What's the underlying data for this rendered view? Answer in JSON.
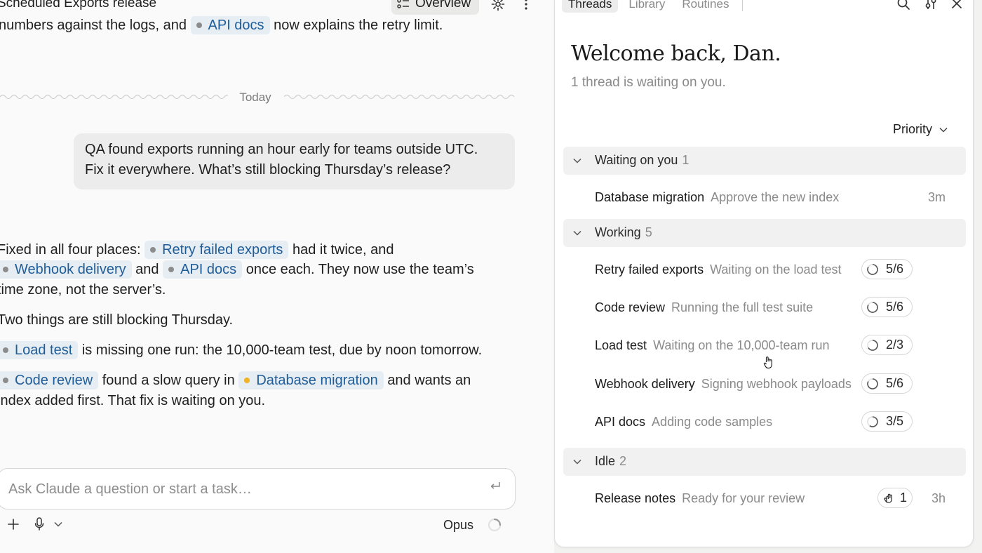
{
  "chat": {
    "header_title": "Scheduled Exports release",
    "overview_label": "Overview",
    "prev_message": {
      "before": "numbers against the logs, and",
      "chip": "API docs",
      "after": "now explains the retry limit."
    },
    "date_divider": "Today",
    "user_message": {
      "line1": "QA found exports running an hour early for teams outside UTC.",
      "line2": "Fix it everywhere. What’s still blocking Thursday’s release?"
    },
    "reply": {
      "p1_a": "Fixed in all four places:",
      "chip_retry": "Retry failed exports",
      "p1_b": "had it twice, and",
      "chip_webhook": "Webhook delivery",
      "p1_c": "and",
      "chip_api": "API docs",
      "p1_d": "once each. They now use the team’s",
      "p1_e": "time zone, not the server’s.",
      "p2": "Two things are still blocking Thursday.",
      "chip_load": "Load test",
      "p3": "is missing one run: the 10,000-team test, due by noon tomorrow.",
      "chip_code": "Code review",
      "p4_a": "found a slow query in",
      "chip_db": "Database migration",
      "p4_b": "and wants an",
      "p4_c": "index added first. That fix is waiting on you."
    },
    "composer_placeholder": "Ask Claude a question or start a task…",
    "model_label": "Opus"
  },
  "panel": {
    "tabs": [
      "Threads",
      "Library",
      "Routines"
    ],
    "welcome": "Welcome back, Dan.",
    "subtitle": "1 thread is waiting on you.",
    "sort_label": "Priority",
    "groups": [
      {
        "name": "Waiting on you",
        "count": "1",
        "rows": [
          {
            "title": "Database migration",
            "subtitle": "Approve the new index",
            "time": "3m"
          }
        ]
      },
      {
        "name": "Working",
        "count": "5",
        "rows": [
          {
            "title": "Retry failed exports",
            "subtitle": "Waiting on the load test",
            "progress": "5/6"
          },
          {
            "title": "Code review",
            "subtitle": "Running the full test suite",
            "progress": "5/6"
          },
          {
            "title": "Load test",
            "subtitle": "Waiting on the 10,000-team run",
            "progress": "2/3"
          },
          {
            "title": "Webhook delivery",
            "subtitle": "Signing webhook payloads",
            "progress": "5/6"
          },
          {
            "title": "API docs",
            "subtitle": "Adding code samples",
            "progress": "3/5"
          }
        ]
      },
      {
        "name": "Idle",
        "count": "2",
        "rows": [
          {
            "title": "Release notes",
            "subtitle": "Ready for your review",
            "badge": "1",
            "time": "3h"
          }
        ]
      }
    ]
  },
  "colors": {
    "chip_bg": "#e6edf3",
    "chip_text": "#1f5d99",
    "pending_dot": "#f0b323"
  }
}
